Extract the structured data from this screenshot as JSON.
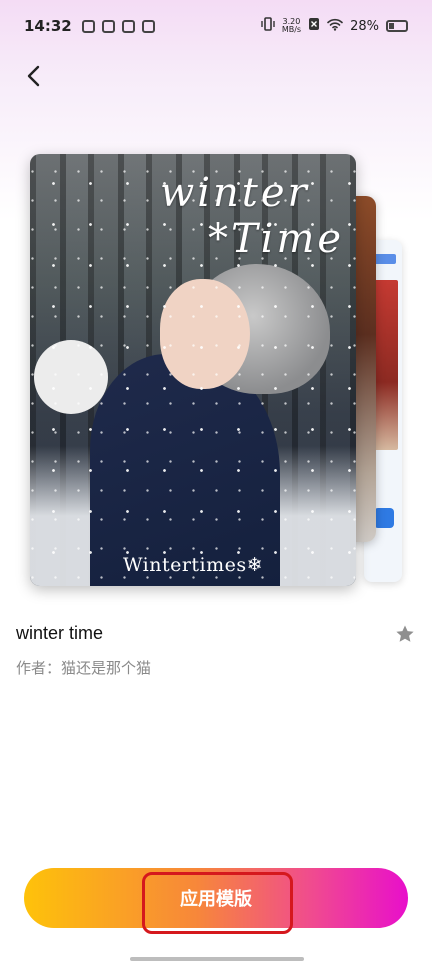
{
  "status_bar": {
    "time": "14:32",
    "net_speed_value": "3.20",
    "net_speed_unit": "MB/s",
    "battery": "28%"
  },
  "template": {
    "card_title_line1": "winter",
    "card_title_line2": "*Time",
    "card_caption": "Wintertimes❄",
    "name": "winter time",
    "author": "作者：猫还是那个猫"
  },
  "actions": {
    "apply_label": "应用模版"
  },
  "colors": {
    "button_gradient_start": "#fec20a",
    "button_gradient_end": "#e80fcb",
    "highlight": "#d5181d"
  }
}
